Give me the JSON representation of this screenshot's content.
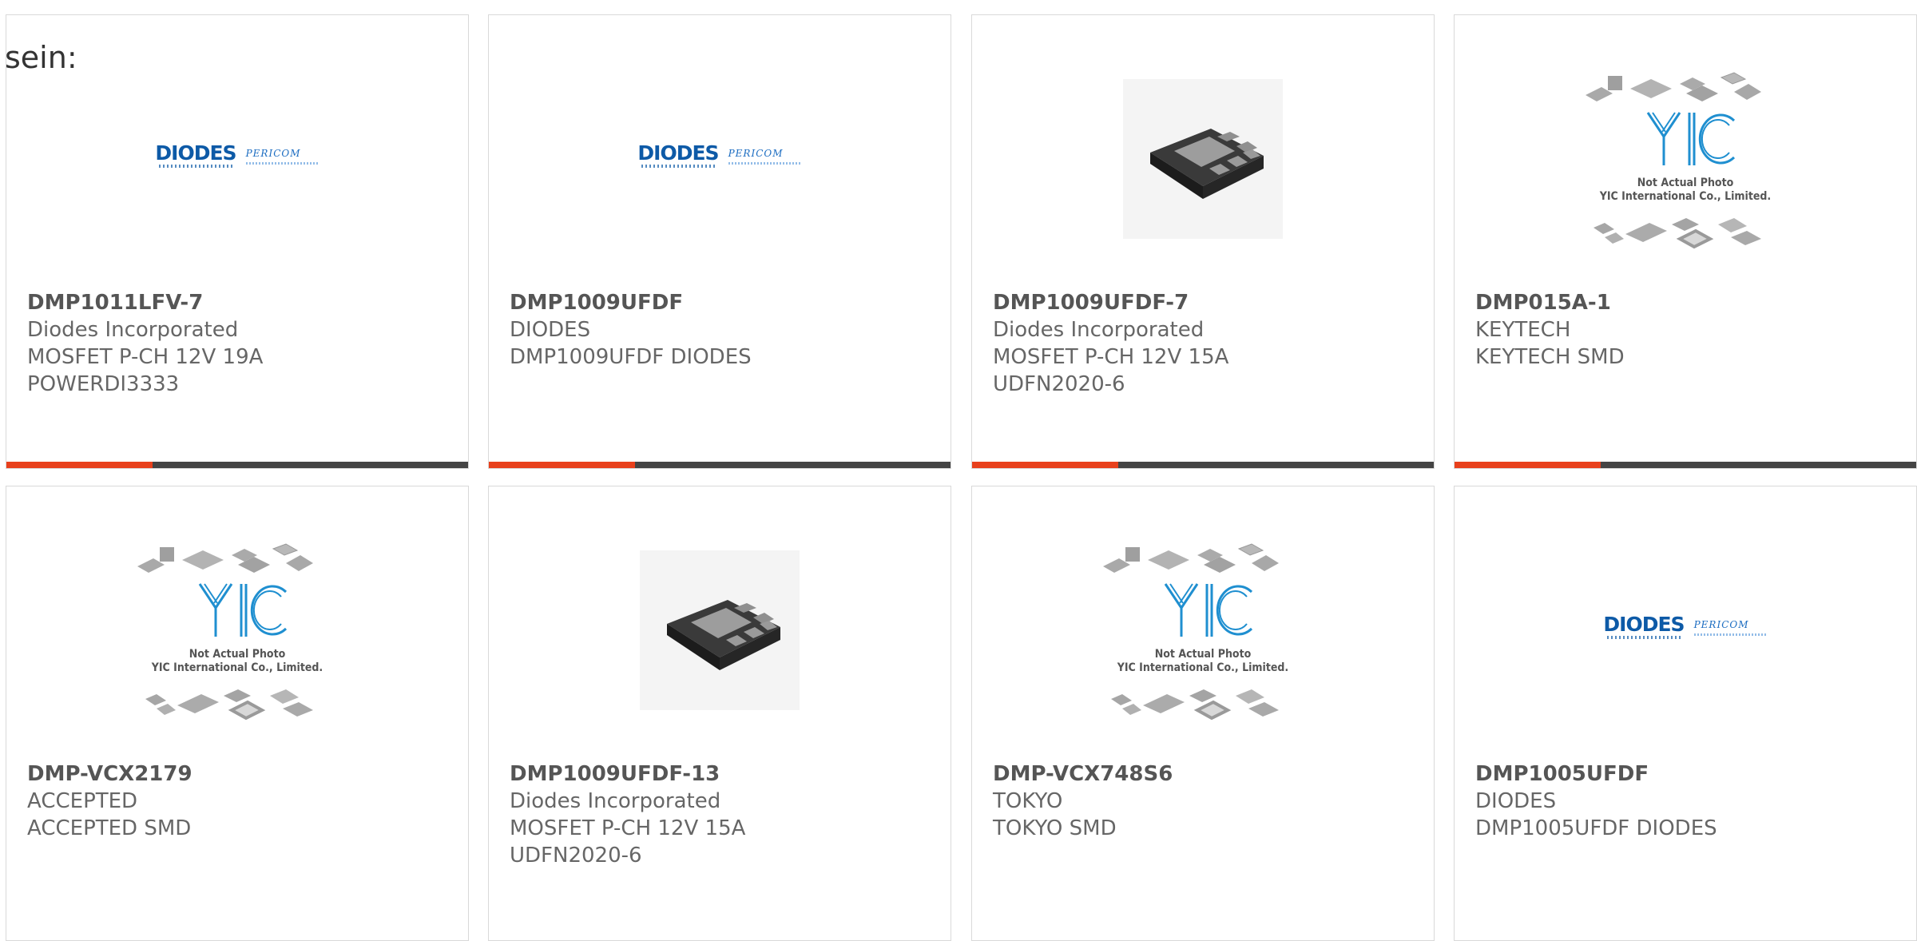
{
  "lead_text": "sein:",
  "products": [
    {
      "part": "DMP1011LFV-7",
      "lines": [
        "Diodes Incorporated",
        "MOSFET P-CH 12V 19A",
        "POWERDI3333"
      ],
      "image": "diodes-pericom-logo"
    },
    {
      "part": "DMP1009UFDF",
      "lines": [
        "DIODES",
        "DMP1009UFDF DIODES"
      ],
      "image": "diodes-pericom-logo"
    },
    {
      "part": "DMP1009UFDF-7",
      "lines": [
        "Diodes Incorporated",
        "MOSFET P-CH 12V 15A",
        "UDFN2020-6"
      ],
      "image": "udfn-chip-photo"
    },
    {
      "part": "DMP015A-1",
      "lines": [
        "KEYTECH",
        "KEYTECH SMD"
      ],
      "image": "yic-placeholder"
    },
    {
      "part": "DMP-VCX2179",
      "lines": [
        "ACCEPTED",
        "ACCEPTED SMD"
      ],
      "image": "yic-placeholder"
    },
    {
      "part": "DMP1009UFDF-13",
      "lines": [
        "Diodes Incorporated",
        "MOSFET P-CH 12V 15A",
        "UDFN2020-6"
      ],
      "image": "udfn-chip-photo"
    },
    {
      "part": "DMP-VCX748S6",
      "lines": [
        "TOKYO",
        "TOKYO SMD"
      ],
      "image": "yic-placeholder"
    },
    {
      "part": "DMP1005UFDF",
      "lines": [
        "DIODES",
        "DMP1005UFDF DIODES"
      ],
      "image": "diodes-pericom-logo"
    }
  ],
  "logo_text": {
    "diodes": "DIODES",
    "pericom": "PERICOM"
  },
  "yic_caption": {
    "line1": "Not Actual Photo",
    "line2": "YIC International Co., Limited."
  },
  "colors": {
    "accent": "#e8401c",
    "bar": "#444444",
    "diodes_blue": "#0d5aa7",
    "yic_blue": "#1f8fd0"
  }
}
